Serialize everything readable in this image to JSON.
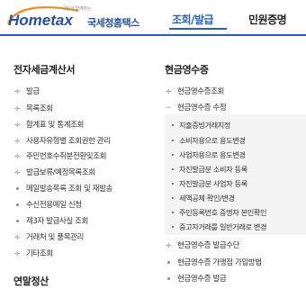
{
  "header": {
    "logo_slogan": "국민과 함께하는",
    "logo_text": "Hometax",
    "logo_korean": "국세청홈택스",
    "tabs": [
      {
        "label": "조회/발급",
        "active": true
      },
      {
        "label": "민원증명",
        "active": false
      }
    ],
    "accent_color": "#2d5fae"
  },
  "left": {
    "title": "전자세금계산서",
    "items": [
      {
        "marker": "plus",
        "label": "발급"
      },
      {
        "marker": "plus",
        "label": "목록조회"
      },
      {
        "marker": "plus",
        "label": "합계표 및 통계조회"
      },
      {
        "marker": "plus",
        "label": "사용자유형별 조회권한 관리"
      },
      {
        "marker": "plus",
        "label": "주민번호수취분전환및조회"
      },
      {
        "marker": "plus",
        "label": "발급보류/예정목록조회"
      },
      {
        "marker": "dot",
        "label": "메일발송목록 조회 및 재발송"
      },
      {
        "marker": "dot",
        "label": "수신전용메일 신청"
      },
      {
        "marker": "dot",
        "label": "제3자 발급사실 조회"
      },
      {
        "marker": "plus",
        "label": "거래처 및 품목관리"
      },
      {
        "marker": "plus",
        "label": "기타조회"
      }
    ],
    "next_title": "연말정산"
  },
  "right": {
    "title": "현금영수증",
    "items": [
      {
        "marker": "plus",
        "label": "현금영수증조회"
      },
      {
        "marker": "minus",
        "label": "현금영수증 수정"
      }
    ],
    "sub_items": [
      "지출증빙거래지정",
      "소비자용으로 용도변경",
      "사업자용으로 용도변경",
      "자진발급분 소비자 등록",
      "자진발급분 사업자 등록",
      "세액공제 확인/변경",
      "주민등록번호 증명자 본인확인",
      "중고자거래를 일반거래로 변경"
    ],
    "items_after": [
      {
        "marker": "plus",
        "label": "현금영수증 발급수단"
      },
      {
        "marker": "dot",
        "label": "현금영수증 가맹점 가입방법"
      },
      {
        "marker": "dot",
        "label": "현금영수증 발급"
      }
    ]
  }
}
